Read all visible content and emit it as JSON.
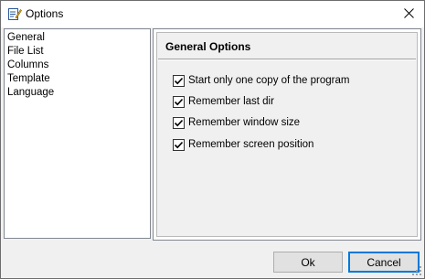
{
  "window": {
    "title": "Options",
    "close_glyph": "✕",
    "icon": "options-app-icon"
  },
  "nav": {
    "items": [
      {
        "label": "General"
      },
      {
        "label": "File List"
      },
      {
        "label": "Columns"
      },
      {
        "label": "Template"
      },
      {
        "label": "Language"
      }
    ]
  },
  "panel": {
    "title": "General Options",
    "options": [
      {
        "label": "Start only one copy of the program",
        "checked": true
      },
      {
        "label": "Remember last dir",
        "checked": true
      },
      {
        "label": "Remember window size",
        "checked": true
      },
      {
        "label": "Remember screen position",
        "checked": true
      }
    ]
  },
  "buttons": {
    "ok_label": "Ok",
    "cancel_label": "Cancel"
  },
  "colors": {
    "accent": "#0078d7",
    "check": "#000000"
  }
}
